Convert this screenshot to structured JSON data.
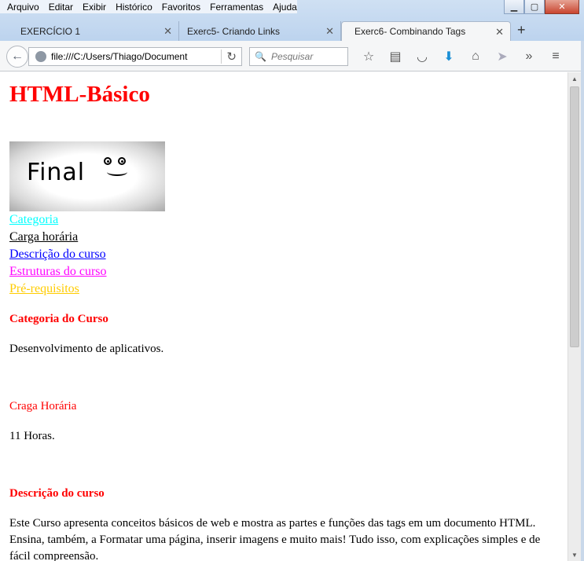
{
  "menu": {
    "items": [
      "Arquivo",
      "Editar",
      "Exibir",
      "Histórico",
      "Favoritos",
      "Ferramentas",
      "Ajuda"
    ]
  },
  "window": {
    "minimize": "▁",
    "maximize": "▢",
    "close": "✕"
  },
  "tabs": [
    {
      "label": "EXERCÍCIO 1"
    },
    {
      "label": "Exerc5- Criando Links"
    },
    {
      "label": "Exerc6- Combinando Tags"
    }
  ],
  "tab_close_glyph": "✕",
  "new_tab_glyph": "+",
  "nav": {
    "back_glyph": "←",
    "url": "file:///C:/Users/Thiago/Document",
    "reload_glyph": "↻",
    "search_placeholder": "Pesquisar",
    "search_glyph": "🔍",
    "icons": [
      "star-icon",
      "reading-list-icon",
      "pocket-icon",
      "download-icon",
      "home-icon",
      "send-icon",
      "overflow-icon",
      "menu-icon"
    ],
    "icon_glyphs": [
      "☆",
      "▤",
      "◡",
      "⬇",
      "⌂",
      "➤",
      "»",
      "≡"
    ]
  },
  "page": {
    "title": "HTML-Básico",
    "image_text": "Final",
    "links": [
      "Categoria",
      "Carga horária",
      "Descrição do curso",
      "Estruturas do curso",
      "Pré-requisitos"
    ],
    "link_colors": [
      "#00ffff",
      "#000000",
      "#0000ff",
      "#ff00ff",
      "#ffcc00"
    ],
    "sections": [
      {
        "heading": "Categoria do Curso",
        "text": "Desenvolvimento de aplicativos."
      },
      {
        "heading": "Craga Horária",
        "text": "11 Horas."
      },
      {
        "heading": "Descrição do curso",
        "text": "Este Curso apresenta conceitos básicos de web e mostra as partes e funções das tags em um documento HTML. Ensina, também, a Formatar uma página, inserir imagens e muito mais! Tudo isso, com explicações simples e de fácil compreensão."
      }
    ]
  },
  "scrollbar": {
    "up_glyph": "▲",
    "down_glyph": "▼"
  },
  "colors": {
    "heading": "#ff0000",
    "accent": "#1a8fd6"
  }
}
